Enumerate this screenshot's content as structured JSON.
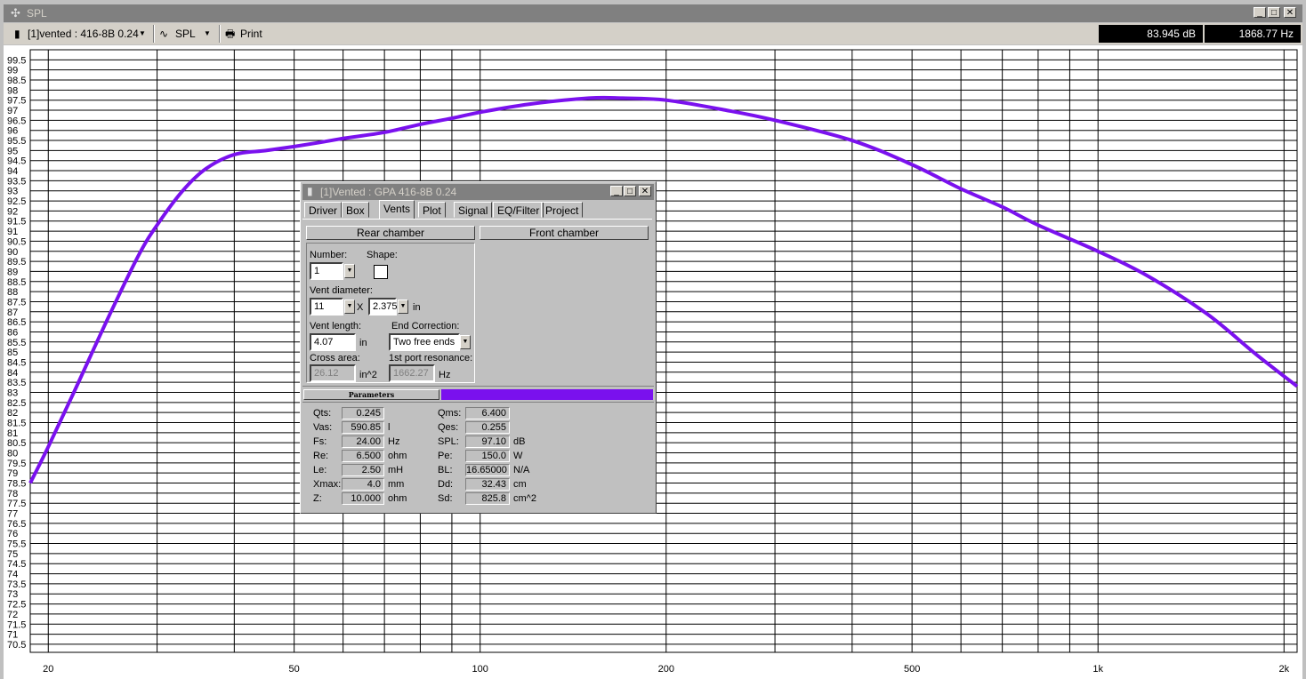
{
  "window": {
    "title": "SPL"
  },
  "toolbar": {
    "project_label": "[1]vented : 416-8B  0.24",
    "mode_label": "SPL",
    "print_label": "Print",
    "readout_db": "83.945 dB",
    "readout_hz": "1868.77 Hz"
  },
  "colors": {
    "curve": "#7a11ee",
    "accent": "#7a11ee"
  },
  "chart_data": {
    "type": "line",
    "x_scale": "log",
    "xlim": [
      18.7,
      2100
    ],
    "ylim": [
      70.1,
      100
    ],
    "y_ticks": [
      "99.5",
      "99",
      "98.5",
      "98",
      "97.5",
      "97",
      "96.5",
      "96",
      "95.5",
      "95",
      "94.5",
      "94",
      "93.5",
      "93",
      "92.5",
      "92",
      "91.5",
      "91",
      "90.5",
      "90",
      "89.5",
      "89",
      "88.5",
      "88",
      "87.5",
      "87",
      "86.5",
      "86",
      "85.5",
      "85",
      "84.5",
      "84",
      "83.5",
      "83",
      "82.5",
      "82",
      "81.5",
      "81",
      "80.5",
      "80",
      "79.5",
      "79",
      "78.5",
      "78",
      "77.5",
      "77",
      "76.5",
      "76",
      "75.5",
      "75",
      "74.5",
      "74",
      "73.5",
      "73",
      "72.5",
      "72",
      "71.5",
      "71",
      "70.5"
    ],
    "x_tick_labels": [
      {
        "x": 20,
        "label": "20"
      },
      {
        "x": 50,
        "label": "50"
      },
      {
        "x": 100,
        "label": "100"
      },
      {
        "x": 200,
        "label": "200"
      },
      {
        "x": 500,
        "label": "500"
      },
      {
        "x": 1000,
        "label": "1k"
      },
      {
        "x": 2000,
        "label": "2k"
      }
    ],
    "grid": true,
    "series": [
      {
        "x": [
          18.7,
          20,
          22,
          25,
          28,
          30,
          33,
          36,
          40,
          45,
          50,
          55,
          60,
          70,
          80,
          90,
          100,
          120,
          150,
          170,
          200,
          250,
          300,
          400,
          500,
          600,
          700,
          800,
          1000,
          1200,
          1500,
          1800,
          2100
        ],
        "y": [
          78.5,
          80.3,
          83.0,
          86.7,
          89.8,
          91.3,
          93.0,
          94.1,
          94.8,
          95.0,
          95.2,
          95.4,
          95.6,
          95.9,
          96.3,
          96.6,
          96.9,
          97.3,
          97.6,
          97.6,
          97.5,
          97.0,
          96.5,
          95.5,
          94.3,
          93.1,
          92.2,
          91.3,
          90.0,
          88.8,
          86.9,
          84.9,
          83.3
        ]
      }
    ]
  },
  "dialog": {
    "title": "[1]Vented : GPA 416-8B  0.24",
    "tabs": [
      "Driver",
      "Box",
      "Vents",
      "Plot",
      "Signal",
      "EQ/Filter",
      "Project"
    ],
    "rear_chamber": "Rear chamber",
    "front_chamber": "Front chamber",
    "number_label": "Number:",
    "number_value": "1",
    "shape_label": "Shape:",
    "vent_diameter_label": "Vent diameter:",
    "vent_d1": "11",
    "times": "X",
    "vent_d2": "2.375",
    "unit_in": "in",
    "vent_length_label": "Vent length:",
    "vent_length_value": "4.07",
    "end_correction_label": "End Correction:",
    "end_correction_value": "Two free ends",
    "cross_area_label": "Cross area:",
    "cross_area_value": "26.12",
    "cross_area_unit": "in^2",
    "port_res_label": "1st port resonance:",
    "port_res_value": "1662.27",
    "port_res_unit": "Hz",
    "params_header": "Parameters",
    "params_left": [
      {
        "label": "Qts:",
        "value": "0.245",
        "unit": ""
      },
      {
        "label": "Vas:",
        "value": "590.85",
        "unit": "l"
      },
      {
        "label": "Fs:",
        "value": "24.00",
        "unit": "Hz"
      },
      {
        "label": "Re:",
        "value": "6.500",
        "unit": "ohm"
      },
      {
        "label": "Le:",
        "value": "2.50",
        "unit": "mH"
      },
      {
        "label": "Xmax:",
        "value": "4.0",
        "unit": "mm"
      },
      {
        "label": "Z:",
        "value": "10.000",
        "unit": "ohm"
      }
    ],
    "params_right": [
      {
        "label": "Qms:",
        "value": "6.400",
        "unit": ""
      },
      {
        "label": "Qes:",
        "value": "0.255",
        "unit": ""
      },
      {
        "label": "SPL:",
        "value": "97.10",
        "unit": "dB"
      },
      {
        "label": "Pe:",
        "value": "150.0",
        "unit": "W"
      },
      {
        "label": "BL:",
        "value": "16.65000",
        "unit": "N/A"
      },
      {
        "label": "Dd:",
        "value": "32.43",
        "unit": "cm"
      },
      {
        "label": "Sd:",
        "value": "825.8",
        "unit": "cm^2"
      }
    ]
  }
}
